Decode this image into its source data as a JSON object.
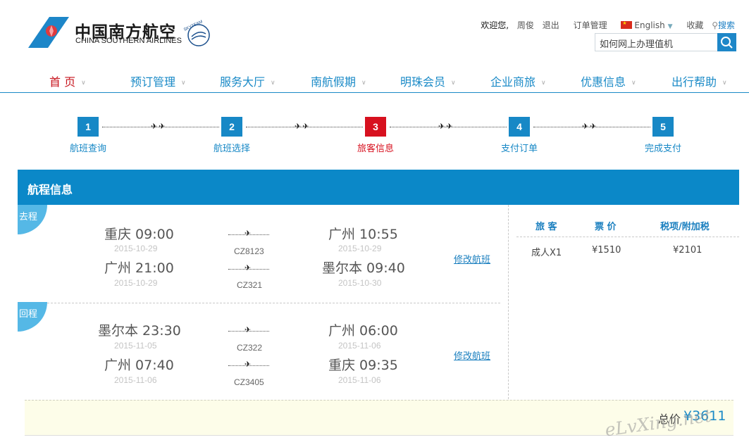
{
  "brand": {
    "name_cn": "中国南方航空",
    "name_en": "CHINA SOUTHERN AIRLINES",
    "alliance": "SKYTEAM"
  },
  "topbar": {
    "welcome": "欢迎您,",
    "user": "周俊",
    "logout": "退出",
    "orders": "订单管理",
    "language": "English",
    "favorites": "收藏",
    "search": "搜索"
  },
  "search": {
    "placeholder": "如何网上办理值机"
  },
  "nav": [
    {
      "label": "首 页"
    },
    {
      "label": "预订管理"
    },
    {
      "label": "服务大厅"
    },
    {
      "label": "南航假期"
    },
    {
      "label": "明珠会员"
    },
    {
      "label": "企业商旅"
    },
    {
      "label": "优惠信息"
    },
    {
      "label": "出行帮助"
    }
  ],
  "steps": [
    {
      "num": "1",
      "label": "航班查询"
    },
    {
      "num": "2",
      "label": "航班选择"
    },
    {
      "num": "3",
      "label": "旅客信息"
    },
    {
      "num": "4",
      "label": "支付订单"
    },
    {
      "num": "5",
      "label": "完成支付"
    }
  ],
  "current_step": 3,
  "panel_title": "航程信息",
  "outbound": {
    "tag": "去程",
    "legs": [
      {
        "dep": "重庆  09:00",
        "dep_date": "2015-10-29",
        "flight": "CZ8123",
        "arr": "广州  10:55",
        "arr_date": "2015-10-29"
      },
      {
        "dep": "广州  21:00",
        "dep_date": "2015-10-29",
        "flight": "CZ321",
        "arr": "墨尔本  09:40",
        "arr_date": "2015-10-30"
      }
    ],
    "modify": "修改航班"
  },
  "return": {
    "tag": "回程",
    "legs": [
      {
        "dep": "墨尔本  23:30",
        "dep_date": "2015-11-05",
        "flight": "CZ322",
        "arr": "广州  06:00",
        "arr_date": "2015-11-06"
      },
      {
        "dep": "广州  07:40",
        "dep_date": "2015-11-06",
        "flight": "CZ3405",
        "arr": "重庆  09:35",
        "arr_date": "2015-11-06"
      }
    ],
    "modify": "修改航班"
  },
  "price_table": {
    "headers": [
      "旅 客",
      "票 价",
      "税项/附加税"
    ],
    "row": [
      "成人X1",
      "¥1510",
      "¥2101"
    ]
  },
  "total": {
    "label": "总价",
    "value": "¥3611"
  },
  "watermark": "eLvXing.net",
  "colors": {
    "brand_blue": "#0b88c8",
    "accent_red": "#d7111f",
    "total_bg": "#fdfde9"
  }
}
